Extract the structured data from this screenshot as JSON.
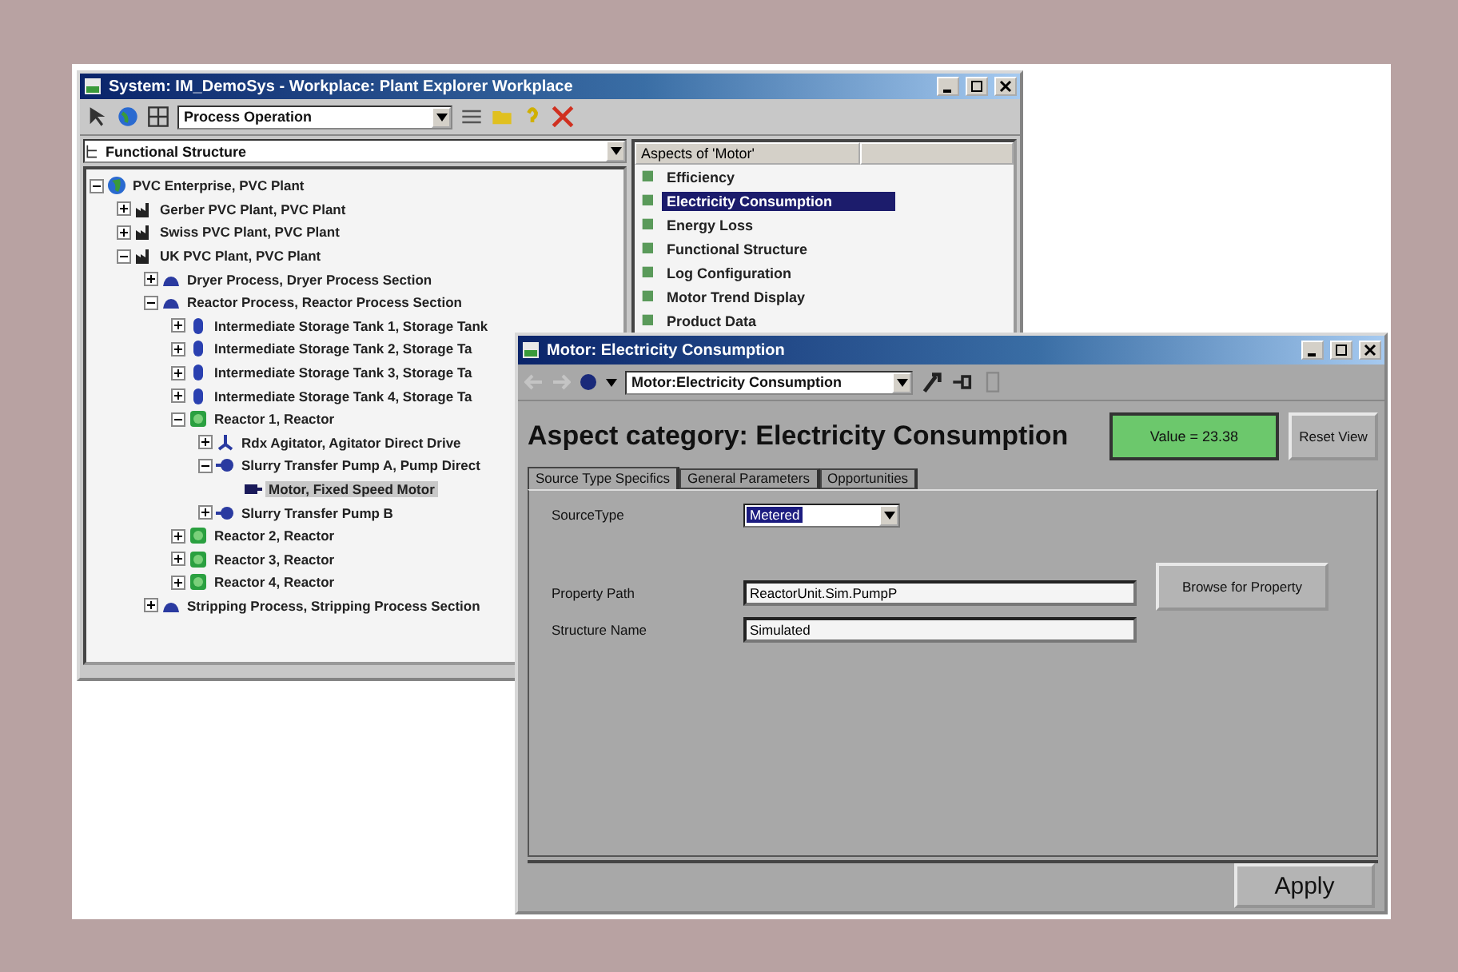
{
  "explorer": {
    "title": "System: IM_DemoSys - Workplace: Plant Explorer Workplace",
    "toolbar_combo": "Process Operation",
    "structure_selector": "Functional Structure",
    "tree": [
      {
        "label": "PVC Enterprise, PVC Plant",
        "kind": "enterprise",
        "expanded": true,
        "selected": false,
        "children": [
          {
            "label": "Gerber PVC Plant, PVC Plant",
            "kind": "plant",
            "expanded": false,
            "selected": false
          },
          {
            "label": "Swiss PVC Plant, PVC Plant",
            "kind": "plant",
            "expanded": false,
            "selected": false
          },
          {
            "label": "UK PVC Plant, PVC Plant",
            "kind": "plant",
            "expanded": true,
            "selected": false,
            "children": [
              {
                "label": "Dryer Process, Dryer Process Section",
                "kind": "section",
                "expanded": false,
                "selected": false
              },
              {
                "label": "Reactor Process, Reactor Process Section",
                "kind": "section",
                "expanded": true,
                "selected": false,
                "children": [
                  {
                    "label": "Intermediate Storage Tank 1, Storage Tank",
                    "kind": "tank",
                    "expanded": false,
                    "selected": false
                  },
                  {
                    "label": "Intermediate Storage Tank 2, Storage Ta",
                    "kind": "tank",
                    "expanded": false,
                    "selected": false
                  },
                  {
                    "label": "Intermediate Storage Tank 3, Storage Ta",
                    "kind": "tank",
                    "expanded": false,
                    "selected": false
                  },
                  {
                    "label": "Intermediate Storage Tank 4, Storage Ta",
                    "kind": "tank",
                    "expanded": false,
                    "selected": false
                  },
                  {
                    "label": "Reactor 1, Reactor",
                    "kind": "reactor",
                    "expanded": true,
                    "selected": false,
                    "children": [
                      {
                        "label": "Rdx Agitator, Agitator Direct Drive",
                        "kind": "agitator",
                        "expanded": false,
                        "selected": false
                      },
                      {
                        "label": "Slurry Transfer Pump A, Pump Direct",
                        "kind": "pump",
                        "expanded": true,
                        "selected": false,
                        "children": [
                          {
                            "label": "Motor, Fixed Speed Motor",
                            "kind": "motor",
                            "selected": true
                          }
                        ]
                      },
                      {
                        "label": "Slurry Transfer Pump B",
                        "kind": "pump",
                        "expanded": false,
                        "selected": false
                      }
                    ]
                  },
                  {
                    "label": "Reactor 2, Reactor",
                    "kind": "reactor",
                    "expanded": false,
                    "selected": false
                  },
                  {
                    "label": "Reactor 3, Reactor",
                    "kind": "reactor",
                    "expanded": false,
                    "selected": false
                  },
                  {
                    "label": "Reactor 4, Reactor",
                    "kind": "reactor",
                    "expanded": false,
                    "selected": false
                  }
                ]
              },
              {
                "label": "Stripping Process, Stripping Process Section",
                "kind": "section",
                "expanded": false,
                "selected": false
              }
            ]
          }
        ]
      }
    ],
    "aspects_header": "Aspects of 'Motor'",
    "aspects": [
      {
        "label": "Efficiency",
        "selected": false
      },
      {
        "label": "Electricity Consumption",
        "selected": true
      },
      {
        "label": "Energy Loss",
        "selected": false
      },
      {
        "label": "Functional Structure",
        "selected": false
      },
      {
        "label": "Log Configuration",
        "selected": false
      },
      {
        "label": "Motor Trend Display",
        "selected": false
      },
      {
        "label": "Product Data",
        "selected": false
      }
    ]
  },
  "aspect_window": {
    "title": "Motor: Electricity Consumption",
    "nav": [
      {
        "kind": "back",
        "disabled": true
      },
      {
        "kind": "forward",
        "disabled": true
      }
    ],
    "toolbar_combo": "Motor:Electricity Consumption",
    "heading": "Aspect category: Electricity Consumption",
    "value_indicator": "Value = 23.38",
    "reset_button": "Reset View",
    "tabs": [
      {
        "label": "Source Type Specifics",
        "selected": true
      },
      {
        "label": "General Parameters",
        "selected": false
      },
      {
        "label": "Opportunities",
        "selected": false
      }
    ],
    "fields": [
      {
        "label": "SourceType",
        "kind": "dropdown",
        "value": "Metered"
      },
      {
        "label": "Property Path",
        "kind": "text",
        "value": "ReactorUnit.Sim.PumpP"
      },
      {
        "label": "Structure Name",
        "kind": "text",
        "value": "Simulated"
      }
    ],
    "browse_button": "Browse for Property",
    "apply_button": "Apply"
  }
}
